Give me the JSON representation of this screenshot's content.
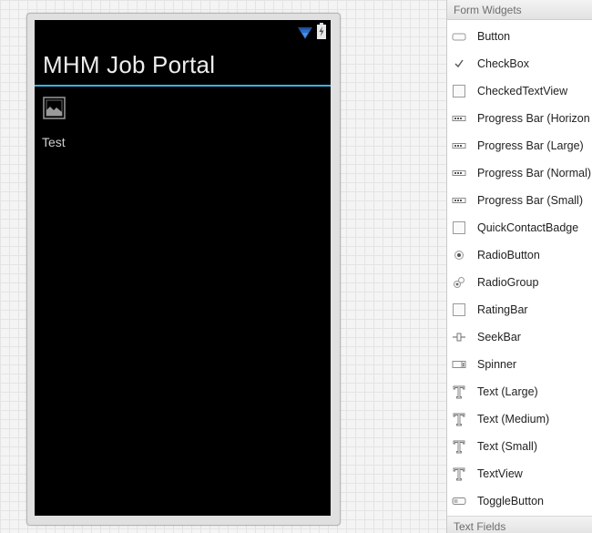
{
  "device": {
    "app_title": "MHM Job Portal",
    "content_text": "Test",
    "colors": {
      "screen": "#000000",
      "accent": "#33b5e5",
      "wifi": "#2a6fc9"
    }
  },
  "palette": {
    "section_title": "Form Widgets",
    "next_section_title": "Text Fields",
    "items": [
      {
        "label": "Button",
        "icon": "button-icon"
      },
      {
        "label": "CheckBox",
        "icon": "checkbox-icon"
      },
      {
        "label": "CheckedTextView",
        "icon": "checked-text-view-icon"
      },
      {
        "label": "Progress Bar (Horizon",
        "icon": "progress-bar-icon"
      },
      {
        "label": "Progress Bar (Large)",
        "icon": "progress-bar-icon"
      },
      {
        "label": "Progress Bar (Normal)",
        "icon": "progress-bar-icon"
      },
      {
        "label": "Progress Bar (Small)",
        "icon": "progress-bar-icon"
      },
      {
        "label": "QuickContactBadge",
        "icon": "quick-contact-badge-icon"
      },
      {
        "label": "RadioButton",
        "icon": "radio-button-icon"
      },
      {
        "label": "RadioGroup",
        "icon": "radio-group-icon"
      },
      {
        "label": "RatingBar",
        "icon": "rating-bar-icon"
      },
      {
        "label": "SeekBar",
        "icon": "seek-bar-icon"
      },
      {
        "label": "Spinner",
        "icon": "spinner-icon"
      },
      {
        "label": "Text (Large)",
        "icon": "text-icon"
      },
      {
        "label": "Text (Medium)",
        "icon": "text-icon"
      },
      {
        "label": "Text (Small)",
        "icon": "text-icon"
      },
      {
        "label": "TextView",
        "icon": "text-icon"
      },
      {
        "label": "ToggleButton",
        "icon": "toggle-button-icon"
      }
    ]
  }
}
